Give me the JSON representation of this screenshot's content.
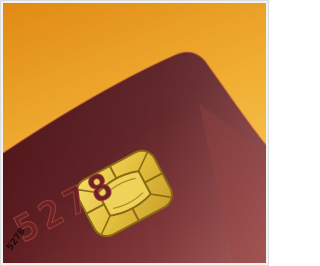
{
  "photo": {
    "subject_icon": "credit-card-chip-closeup",
    "colors": {
      "background_top": "#e89a1c",
      "background_bottom": "#f6c24a",
      "card_dark": "#3c1215",
      "card_mid": "#5e1e22",
      "card_light": "#8a3435",
      "chip_gold": "#e8c84a",
      "chip_shadow": "#9e7a1c",
      "embossed_numbers": "#7a2a2a"
    },
    "card_number_fragment": "5278",
    "small_print_fragment": "5278"
  }
}
